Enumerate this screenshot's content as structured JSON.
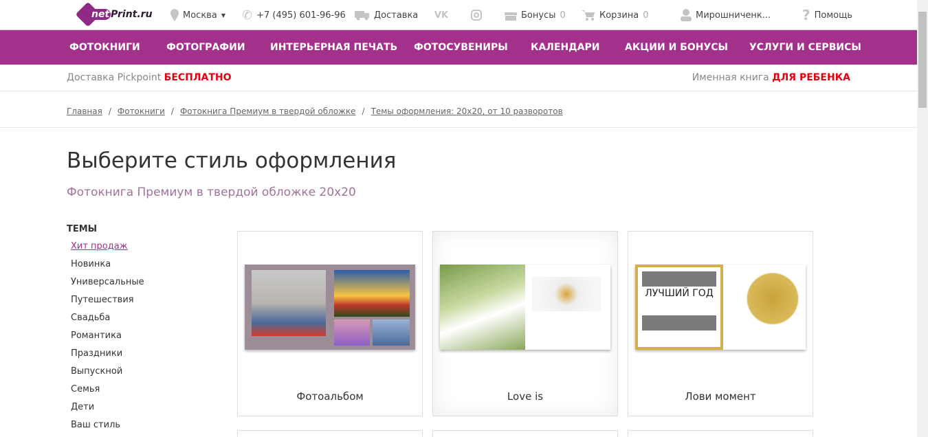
{
  "header": {
    "logo": "netPrint.ru",
    "city": "Москва",
    "phone": "+7 (495) 601-96-96",
    "delivery": "Доставка",
    "bonuses": "Бонусы",
    "bonuses_count": "0",
    "cart": "Корзина",
    "cart_count": "0",
    "user": "Мирошниченк...",
    "help": "Помощь"
  },
  "nav": [
    "ФОТОКНИГИ",
    "ФОТОГРАФИИ",
    "ИНТЕРЬЕРНАЯ ПЕЧАТЬ",
    "ФОТОСУВЕНИРЫ",
    "КАЛЕНДАРИ",
    "АКЦИИ И БОНУСЫ",
    "УСЛУГИ И СЕРВИСЫ"
  ],
  "promo": {
    "left": "Доставка Pickpoint ",
    "left_accent": "БЕСПЛАТНО",
    "right": "Именная книга ",
    "right_accent": "ДЛЯ РЕБЕНКА"
  },
  "breadcrumb": [
    "Главная",
    "Фотокниги",
    "Фотокнига Премиум в твердой обложке",
    "Темы оформления: 20х20, от 10 разворотов"
  ],
  "title": "Выберите стиль оформления",
  "subtitle": "Фотокнига Премиум в твердой обложке 20х20",
  "sidebar": {
    "heading": "ТЕМЫ",
    "items": [
      "Хит продаж",
      "Новинка",
      "Универсальные",
      "Путешествия",
      "Свадьба",
      "Романтика",
      "Праздники",
      "Выпускной",
      "Семья",
      "Дети",
      "Ваш стиль"
    ],
    "active": "Хит продаж"
  },
  "cards": [
    {
      "name": "Фотоальбом"
    },
    {
      "name": "Love is"
    },
    {
      "name": "Лови момент"
    }
  ],
  "colors": {
    "brand": "#a3308b",
    "accent": "#e5000f"
  }
}
